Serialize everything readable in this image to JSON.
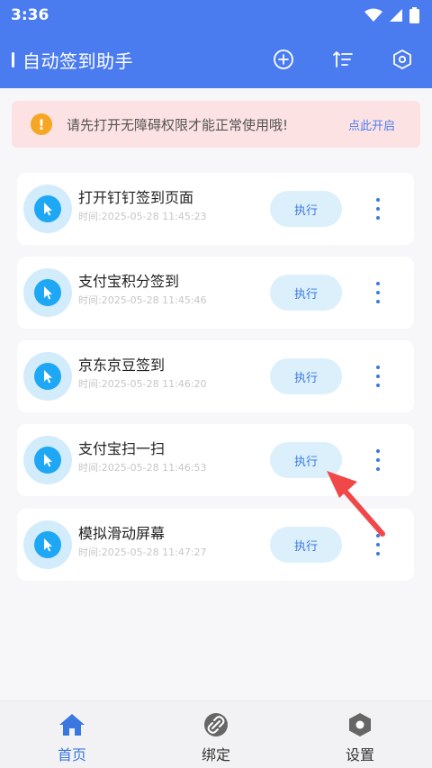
{
  "status_bar": {
    "time": "3:36"
  },
  "app_bar": {
    "title": "自动签到助手"
  },
  "banner": {
    "message": "请先打开无障碍权限才能正常使用哦!",
    "link": "点此开启"
  },
  "tasks": [
    {
      "name": "打开钉钉签到页面",
      "time": "时间:2025-05-28 11:45:23",
      "action": "执行"
    },
    {
      "name": "支付宝积分签到",
      "time": "时间:2025-05-28 11:45:46",
      "action": "执行"
    },
    {
      "name": "京东京豆签到",
      "time": "时间:2025-05-28 11:46:20",
      "action": "执行"
    },
    {
      "name": "支付宝扫一扫",
      "time": "时间:2025-05-28 11:46:53",
      "action": "执行"
    },
    {
      "name": "模拟滑动屏幕",
      "time": "时间:2025-05-28 11:47:27",
      "action": "执行"
    }
  ],
  "tab_bar": {
    "items": [
      {
        "label": "首页",
        "icon": "home-icon"
      },
      {
        "label": "绑定",
        "icon": "link-icon"
      },
      {
        "label": "设置",
        "icon": "settings-icon"
      }
    ],
    "active_index": 0
  },
  "colors": {
    "primary": "#4a7cf0",
    "banner_bg": "#fde2e4",
    "warning": "#f5a623",
    "accent": "#1ea7f5",
    "annotation_arrow": "#f04848"
  }
}
